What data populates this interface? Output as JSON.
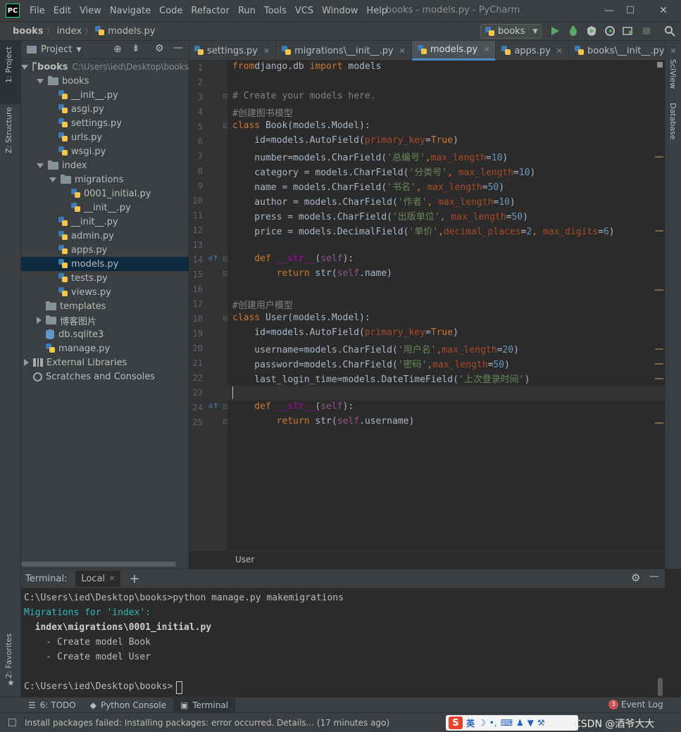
{
  "app": {
    "logo": "PC",
    "window_title": "books - models.py - PyCharm",
    "icon": "pycharm-logo-icon"
  },
  "menu": [
    "File",
    "Edit",
    "View",
    "Navigate",
    "Code",
    "Refactor",
    "Run",
    "Tools",
    "VCS",
    "Window",
    "Help"
  ],
  "window_controls": {
    "minimize": "—",
    "maximize": "☐",
    "close": "✕"
  },
  "breadcrumb": {
    "project": "books",
    "folder": "index",
    "file": "models.py"
  },
  "run_config": {
    "label": "books"
  },
  "side_tabs": {
    "left_top": "1: Project",
    "left_mid": "Z: Structure",
    "left_bottom": "2: Favorites",
    "right_top": "SciView",
    "right_mid": "Database"
  },
  "project_panel": {
    "title": "Project",
    "rows": [
      {
        "label": "books",
        "extra": "C:\\Users\\ied\\Desktop\\books",
        "kind": "folder",
        "indent": 0,
        "arrow": "down",
        "bold": true
      },
      {
        "label": "books",
        "kind": "folder",
        "indent": 1,
        "arrow": "down"
      },
      {
        "label": "__init__.py",
        "kind": "py",
        "indent": 2
      },
      {
        "label": "asgi.py",
        "kind": "py",
        "indent": 2
      },
      {
        "label": "settings.py",
        "kind": "py",
        "indent": 2
      },
      {
        "label": "urls.py",
        "kind": "py",
        "indent": 2
      },
      {
        "label": "wsgi.py",
        "kind": "py",
        "indent": 2
      },
      {
        "label": "index",
        "kind": "folder",
        "indent": 1,
        "arrow": "down"
      },
      {
        "label": "migrations",
        "kind": "folder",
        "indent": 2,
        "arrow": "down"
      },
      {
        "label": "0001_initial.py",
        "kind": "py",
        "indent": 3
      },
      {
        "label": "__init__.py",
        "kind": "py",
        "indent": 3
      },
      {
        "label": "__init__.py",
        "kind": "py",
        "indent": 2
      },
      {
        "label": "admin.py",
        "kind": "py",
        "indent": 2
      },
      {
        "label": "apps.py",
        "kind": "py",
        "indent": 2
      },
      {
        "label": "models.py",
        "kind": "py",
        "indent": 2,
        "selected": true
      },
      {
        "label": "tests.py",
        "kind": "py",
        "indent": 2
      },
      {
        "label": "views.py",
        "kind": "py",
        "indent": 2
      },
      {
        "label": "templates",
        "kind": "folder",
        "indent": 1
      },
      {
        "label": "博客图片",
        "kind": "folder",
        "indent": 1,
        "arrow": "right"
      },
      {
        "label": "db.sqlite3",
        "kind": "db",
        "indent": 1
      },
      {
        "label": "manage.py",
        "kind": "py",
        "indent": 1
      },
      {
        "label": "External Libraries",
        "kind": "lib",
        "indent": 0,
        "arrow": "right"
      },
      {
        "label": "Scratches and Consoles",
        "kind": "scratch",
        "indent": 0
      }
    ]
  },
  "editor_tabs": [
    {
      "label": "settings.py",
      "active": false
    },
    {
      "label": "migrations\\__init__.py",
      "active": false
    },
    {
      "label": "models.py",
      "active": true
    },
    {
      "label": "apps.py",
      "active": false
    },
    {
      "label": "books\\__init__.py",
      "active": false
    }
  ],
  "code_lines": [
    [
      [
        "kw",
        "from"
      ],
      [
        "",
        "django.db "
      ],
      [
        "kw",
        "import"
      ],
      [
        "",
        " models"
      ]
    ],
    [],
    [
      [
        "cmt",
        "# Create your models here."
      ]
    ],
    [
      [
        "cmt",
        "#创建图书模型"
      ]
    ],
    [
      [
        "kw",
        "class "
      ],
      [
        "cls",
        "Book"
      ],
      [
        "",
        "(models.Model):"
      ]
    ],
    [
      [
        "",
        "    id=models.AutoField("
      ],
      [
        "prm",
        "primary_key"
      ],
      [
        "",
        "="
      ],
      [
        "kw",
        "True"
      ],
      [
        "",
        ")"
      ]
    ],
    [
      [
        "",
        "    number=models.CharField("
      ],
      [
        "str",
        "'总编号'"
      ],
      [
        "kw",
        ","
      ],
      [
        "prm",
        "max_length"
      ],
      [
        "",
        "="
      ],
      [
        "num",
        "10"
      ],
      [
        "",
        ")"
      ]
    ],
    [
      [
        "",
        "    category = models.CharField("
      ],
      [
        "str",
        "'分类号'"
      ],
      [
        "kw",
        ", "
      ],
      [
        "prm",
        "max_length"
      ],
      [
        "",
        "="
      ],
      [
        "num",
        "10"
      ],
      [
        "",
        ")"
      ]
    ],
    [
      [
        "",
        "    name = models.CharField("
      ],
      [
        "str",
        "'书名'"
      ],
      [
        "kw",
        ", "
      ],
      [
        "prm",
        "max_length"
      ],
      [
        "",
        "="
      ],
      [
        "num",
        "50"
      ],
      [
        "",
        ")"
      ]
    ],
    [
      [
        "",
        "    author = models.CharField("
      ],
      [
        "str",
        "'作者'"
      ],
      [
        "kw",
        ", "
      ],
      [
        "prm",
        "max_length"
      ],
      [
        "",
        "="
      ],
      [
        "num",
        "10"
      ],
      [
        "",
        ")"
      ]
    ],
    [
      [
        "",
        "    press = models.CharField("
      ],
      [
        "str",
        "'出版单位'"
      ],
      [
        "kw",
        ", "
      ],
      [
        "prm",
        "max_length"
      ],
      [
        "",
        "="
      ],
      [
        "num",
        "50"
      ],
      [
        "",
        ")"
      ]
    ],
    [
      [
        "",
        "    price = models.DecimalField("
      ],
      [
        "str",
        "'单价'"
      ],
      [
        "kw",
        ","
      ],
      [
        "prm",
        "decimal_places"
      ],
      [
        "",
        "="
      ],
      [
        "num",
        "2"
      ],
      [
        "kw",
        ", "
      ],
      [
        "prm",
        "max_digits"
      ],
      [
        "",
        "="
      ],
      [
        "num",
        "6"
      ],
      [
        "",
        ")"
      ]
    ],
    [],
    [
      [
        "kw",
        "    def "
      ],
      [
        "mg",
        "__str__"
      ],
      [
        "",
        "("
      ],
      [
        "slf",
        "self"
      ],
      [
        "",
        "):"
      ]
    ],
    [
      [
        "kw",
        "        return "
      ],
      [
        "",
        "str("
      ],
      [
        "slf",
        "self"
      ],
      [
        "",
        ".name)"
      ]
    ],
    [],
    [
      [
        "cmt",
        "#创建用户模型"
      ]
    ],
    [
      [
        "kw",
        "class "
      ],
      [
        "cls",
        "User"
      ],
      [
        "",
        "(models.Model):"
      ]
    ],
    [
      [
        "",
        "    id=models.AutoField("
      ],
      [
        "prm",
        "primary_key"
      ],
      [
        "",
        "="
      ],
      [
        "kw",
        "True"
      ],
      [
        "",
        ")"
      ]
    ],
    [
      [
        "",
        "    username=models.CharField("
      ],
      [
        "str",
        "'用户名'"
      ],
      [
        "kw",
        ","
      ],
      [
        "prm",
        "max_length"
      ],
      [
        "",
        "="
      ],
      [
        "num",
        "20"
      ],
      [
        "",
        ")"
      ]
    ],
    [
      [
        "",
        "    password=models.CharField("
      ],
      [
        "str",
        "'密码'"
      ],
      [
        "kw",
        ","
      ],
      [
        "prm",
        "max_length"
      ],
      [
        "",
        "="
      ],
      [
        "num",
        "50"
      ],
      [
        "",
        ")"
      ]
    ],
    [
      [
        "",
        "    last_login_time=models.DateTimeField("
      ],
      [
        "str",
        "'上次登录时间'"
      ],
      [
        "",
        ")"
      ]
    ],
    [],
    [
      [
        "kw",
        "    def "
      ],
      [
        "mg",
        "__str__"
      ],
      [
        "",
        "("
      ],
      [
        "slf",
        "self"
      ],
      [
        "",
        "):"
      ]
    ],
    [
      [
        "kw",
        "        return "
      ],
      [
        "",
        "str("
      ],
      [
        "slf",
        "self"
      ],
      [
        "",
        ".username)"
      ]
    ]
  ],
  "editor_footer": "User",
  "terminal": {
    "title": "Terminal:",
    "tab": "Local",
    "lines": [
      {
        "text": "C:\\Users\\ied\\Desktop\\books>python manage.py makemigrations",
        "color": "#bbbbbb",
        "bold": false
      },
      {
        "text": "Migrations for 'index':",
        "color": "#2fb8b8",
        "bold": false
      },
      {
        "text": "  index\\migrations\\0001_initial.py",
        "color": "#d0d0d0",
        "bold": true
      },
      {
        "text": "    - Create model Book",
        "color": "#bbbbbb",
        "bold": false
      },
      {
        "text": "    - Create model User",
        "color": "#bbbbbb",
        "bold": false
      },
      {
        "text": "",
        "color": "#bbbbbb",
        "bold": false
      },
      {
        "text": "C:\\Users\\ied\\Desktop\\books>",
        "color": "#bbbbbb",
        "bold": false
      }
    ]
  },
  "bottom_tabs": [
    {
      "label": "6: TODO",
      "icon": "list-icon"
    },
    {
      "label": "Python Console",
      "icon": "python-icon"
    },
    {
      "label": "Terminal",
      "icon": "terminal-icon",
      "active": true
    }
  ],
  "event_log": {
    "count": "3",
    "label": "Event Log"
  },
  "status": {
    "message": "Install packages failed: Installing packages: error occurred. Details... (17 minutes ago)"
  },
  "ime": {
    "lang": "英",
    "watermark": "CSDN @酒爷大大"
  },
  "colors": {
    "accent": "#4a88c7",
    "selection": "#0d293e",
    "bg": "#2b2b2b",
    "panel": "#3c3f41"
  }
}
